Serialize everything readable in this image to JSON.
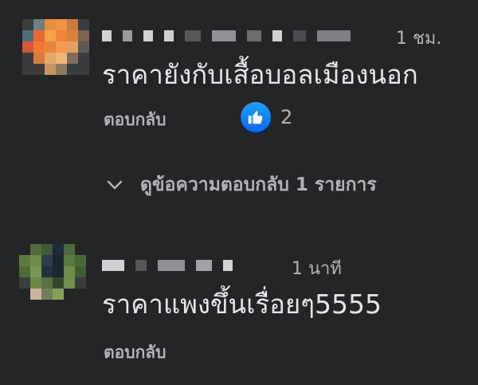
{
  "comments": [
    {
      "author": "",
      "timestamp": "1 ชม.",
      "text": "ราคายังกับเสื้อบอลเมืองนอก",
      "reply_label": "ตอบกลับ",
      "reaction": {
        "icon": "like-icon",
        "count": "2"
      },
      "view_replies_label": "ดูข้อความตอบกลับ 1 รายการ"
    },
    {
      "author": "",
      "timestamp": "1 นาที",
      "text": "ราคาแพงขึ้นเรื่อยๆ5555",
      "reply_label": "ตอบกลับ"
    }
  ],
  "colors": {
    "background": "#242526",
    "primary_text": "#e4e6eb",
    "secondary_text": "#b0b3b8",
    "like_blue": "#0866ff"
  }
}
